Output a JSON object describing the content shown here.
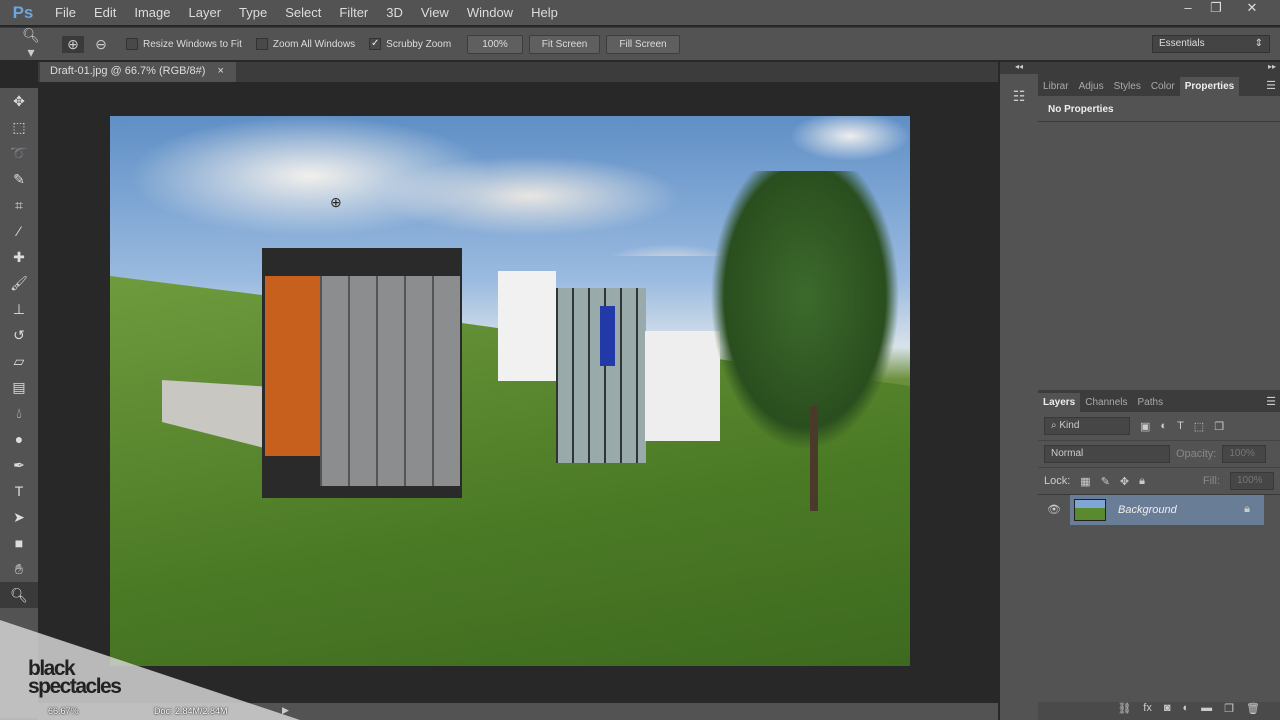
{
  "app": {
    "logo": "Ps",
    "menu": [
      "File",
      "Edit",
      "Image",
      "Layer",
      "Type",
      "Select",
      "Filter",
      "3D",
      "View",
      "Window",
      "Help"
    ],
    "window_controls": [
      "–",
      "❐",
      "✕"
    ]
  },
  "options": {
    "resize_windows": {
      "label": "Resize Windows to Fit",
      "checked": false
    },
    "zoom_all": {
      "label": "Zoom All Windows",
      "checked": false
    },
    "scrubby": {
      "label": "Scrubby Zoom",
      "checked": true
    },
    "btn_100": "100%",
    "fit_screen": "Fit Screen",
    "fill_screen": "Fill Screen",
    "workspace": "Essentials"
  },
  "document": {
    "tab_title": "Draft-01.jpg @ 66.7% (RGB/8#)",
    "close": "×"
  },
  "status": {
    "zoom": "66.67%",
    "doc": "Doc: 2.84M/2.84M"
  },
  "properties_panel": {
    "tabs": [
      "Librar",
      "Adjus",
      "Styles",
      "Color",
      "Properties"
    ],
    "active": "Properties",
    "content": "No Properties"
  },
  "layers_panel": {
    "tabs": [
      "Layers",
      "Channels",
      "Paths"
    ],
    "active": "Layers",
    "filter": "Kind",
    "blend_mode": "Normal",
    "opacity_label": "Opacity:",
    "opacity": "100%",
    "lock_label": "Lock:",
    "fill_label": "Fill:",
    "fill": "100%",
    "layers": [
      {
        "name": "Background",
        "visible": true,
        "locked": true
      }
    ]
  },
  "watermark": {
    "text": "black spectacles"
  }
}
